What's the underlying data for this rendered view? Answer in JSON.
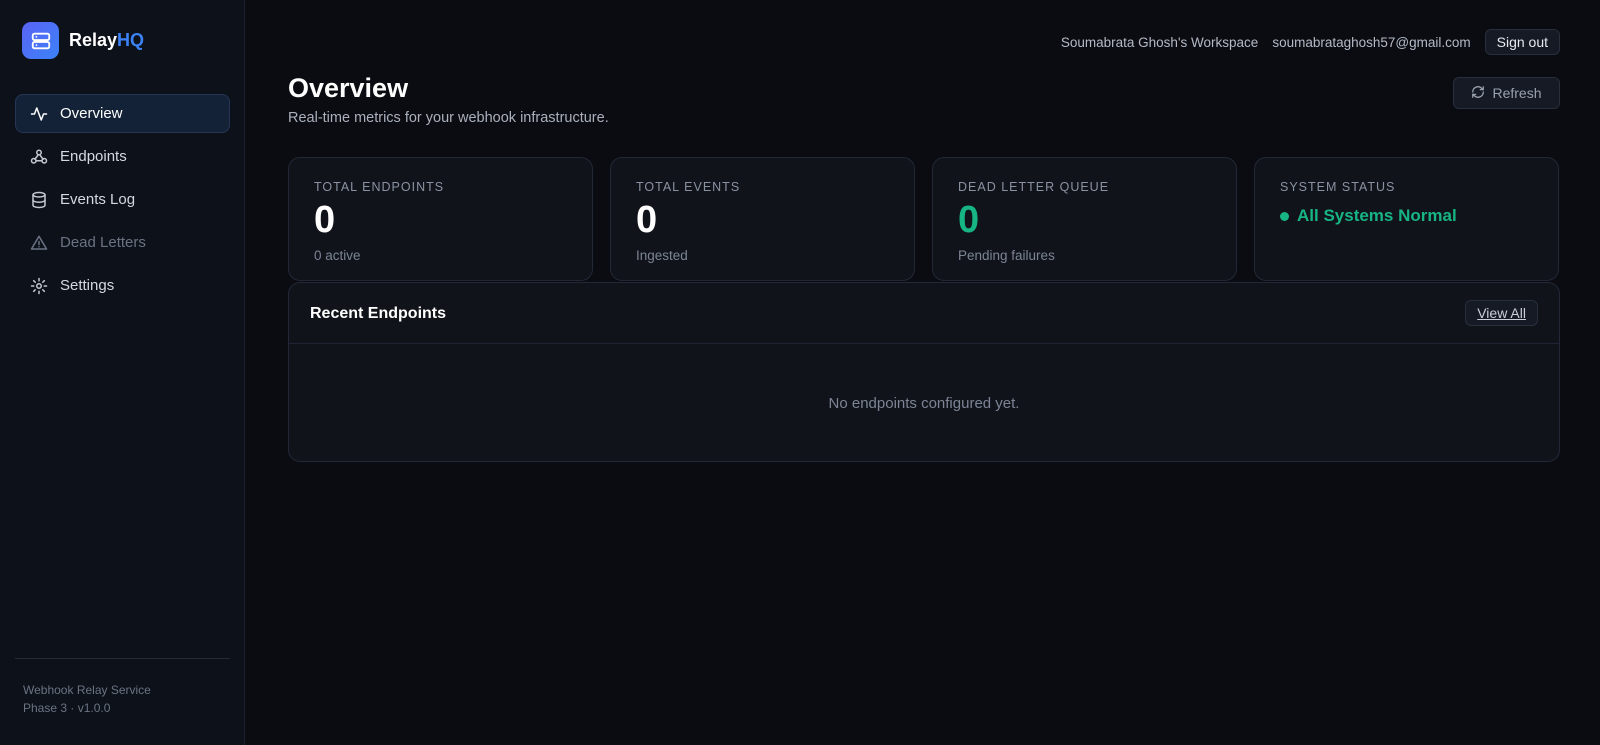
{
  "brand": {
    "name_main": "Relay",
    "name_accent": "HQ",
    "logo_icon": "server-icon",
    "accent_color": "#3b82f6"
  },
  "sidebar": {
    "items": [
      {
        "label": "Overview",
        "icon": "activity-icon",
        "active": true
      },
      {
        "label": "Endpoints",
        "icon": "webhook-icon"
      },
      {
        "label": "Events Log",
        "icon": "database-icon"
      },
      {
        "label": "Dead Letters",
        "icon": "alert-triangle-icon",
        "dimmed": true
      },
      {
        "label": "Settings",
        "icon": "gear-icon"
      }
    ],
    "footer": {
      "line1": "Webhook Relay Service",
      "line2": "Phase 3 · v1.0.0"
    }
  },
  "topbar": {
    "workspace": "Soumabrata Ghosh's Workspace",
    "email": "soumabrataghosh57@gmail.com",
    "signout_label": "Sign out"
  },
  "header": {
    "title": "Overview",
    "subtitle": "Real-time metrics for your webhook infrastructure.",
    "refresh_label": "Refresh"
  },
  "stats": [
    {
      "label": "TOTAL ENDPOINTS",
      "value": "0",
      "sub": "0 active"
    },
    {
      "label": "TOTAL EVENTS",
      "value": "0",
      "sub": "Ingested"
    },
    {
      "label": "DEAD LETTER QUEUE",
      "value": "0",
      "sub": "Pending failures",
      "color": "#17b584"
    },
    {
      "label": "SYSTEM STATUS",
      "status": "All Systems Normal",
      "color": "#17b584"
    }
  ],
  "recent_endpoints": {
    "title": "Recent Endpoints",
    "view_all_label": "View All",
    "empty_text": "No endpoints configured yet."
  }
}
